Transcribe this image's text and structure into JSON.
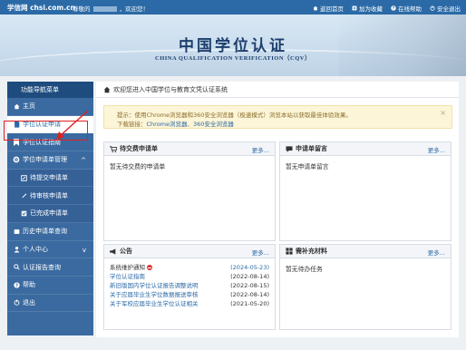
{
  "topbar": {
    "brand": "学信网 chsi.com.cn",
    "greeting_prefix": "尊敬的",
    "greeting_suffix": "，欢迎您！",
    "links": [
      "返回首页",
      "加为收藏",
      "在线帮助",
      "安全退出"
    ],
    "link_icons": [
      "home-icon",
      "bookmark-icon",
      "help-icon",
      "logout-icon"
    ]
  },
  "banner": {
    "title_cn": "中国学位认证",
    "title_en": "CHINA QUALIFICATION VERIFICATION（CQV）"
  },
  "sidebar": {
    "header": "功能导航菜单",
    "items": [
      {
        "label": "主页",
        "icon": "home-icon"
      },
      {
        "label": "学位认证申请",
        "icon": "document-icon"
      },
      {
        "label": "学位认证指南",
        "icon": "bookmark-icon"
      },
      {
        "label": "学位申请单管理",
        "icon": "gear-icon"
      },
      {
        "label": "待提交申请单",
        "icon": "edit-icon"
      },
      {
        "label": "待审核申请单",
        "icon": "pen-icon"
      },
      {
        "label": "已完成申请单",
        "icon": "check-icon"
      },
      {
        "label": "历史申请单查询",
        "icon": "history-icon"
      },
      {
        "label": "个人中心",
        "icon": "user-icon"
      },
      {
        "label": "认证报告查询",
        "icon": "search-icon"
      },
      {
        "label": "帮助",
        "icon": "help-icon"
      },
      {
        "label": "退出",
        "icon": "power-icon"
      }
    ]
  },
  "main": {
    "welcome": "欢迎您进入中国学位与教育文凭认证系统",
    "notice_line1": "提示：使用Chrome浏览器和360安全浏览器（极速模式）浏览本站以获取最佳体验效果。",
    "notice_download_label": "下载链接：",
    "notice_link1": "Chrome浏览器",
    "notice_sep": "、",
    "notice_link2": "360安全浏览器",
    "notice_close": "×"
  },
  "panels": {
    "pending": {
      "title": "待交费申请单",
      "more": "更多...",
      "empty": "暂无待交费的申请单"
    },
    "messages": {
      "title": "申请单留言",
      "more": "更多...",
      "empty": "暂无申请单留言"
    },
    "announcements": {
      "title": "公告",
      "more": "更多...",
      "items": [
        {
          "title": "系统维护通知",
          "date": "(2024-05-23)"
        },
        {
          "title": "学位认证指南",
          "date": "(2022-08-14)"
        },
        {
          "title": "新旧版国内学位认证报告调整说明",
          "date": "(2022-08-15)"
        },
        {
          "title": "关于应届毕业生学位数据报送审核",
          "date": "(2022-08-14)"
        },
        {
          "title": "关于军校应届毕业生学位认证相关",
          "date": "(2021-05-20)"
        }
      ]
    },
    "materials": {
      "title": "需补充材料",
      "more": "更多...",
      "empty": "暂无待办任务"
    }
  },
  "colors": {
    "accent": "#2b6aa6",
    "sidebar": "#3a6aa0",
    "highlight": "#e02020"
  }
}
